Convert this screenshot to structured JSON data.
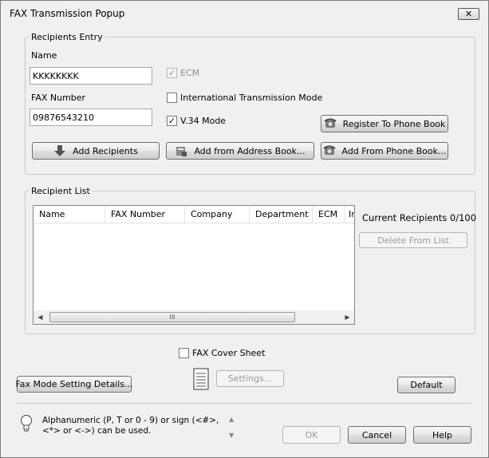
{
  "window": {
    "title": "FAX Transmission Popup",
    "close_glyph": "✕"
  },
  "recipients_entry": {
    "group_label": "Recipients Entry",
    "name_label": "Name",
    "name_value": "KKKKKKKK",
    "fax_label": "FAX Number",
    "fax_value": "09876543210",
    "ecm": {
      "label": "ECM",
      "checked": true,
      "enabled": false
    },
    "international": {
      "label": "International Transmission Mode",
      "checked": false
    },
    "v34": {
      "label": "V.34 Mode",
      "checked": true
    },
    "register_button": "Register To Phone Book",
    "add_recipients_button": "Add Recipients",
    "add_address_book_button": "Add from Address Book...",
    "add_phone_book_button": "Add From Phone Book..."
  },
  "recipient_list": {
    "group_label": "Recipient List",
    "columns": [
      "Name",
      "FAX Number",
      "Company",
      "Department",
      "ECM",
      "In"
    ],
    "rows": [],
    "current_recipients": "Current Recipients 0/100",
    "delete_button": "Delete From List",
    "scroll_thumb_glyph": "III"
  },
  "cover_sheet": {
    "label": "FAX Cover Sheet",
    "checked": false,
    "settings_button": "Settings..."
  },
  "footer": {
    "fax_mode_button": "Fax Mode Setting Details...",
    "default_button": "Default",
    "hint_text": "Alphanumeric (P, T or 0 - 9) or sign (<#>, <*> or <->) can be used.",
    "ok_button": "OK",
    "cancel_button": "Cancel",
    "help_button": "Help"
  }
}
